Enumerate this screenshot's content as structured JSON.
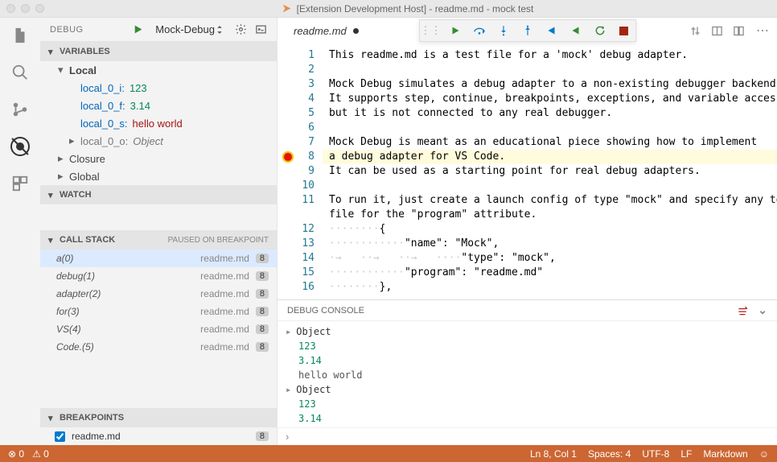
{
  "window": {
    "title": "[Extension Development Host] - readme.md - mock test"
  },
  "debugbar": {
    "label": "DEBUG",
    "config": "Mock-Debug"
  },
  "sections": {
    "variables": "VARIABLES",
    "watch": "WATCH",
    "callstack": "CALL STACK",
    "callstack_status": "PAUSED ON BREAKPOINT",
    "breakpoints": "BREAKPOINTS"
  },
  "vars": {
    "scope_local": "Local",
    "scope_closure": "Closure",
    "scope_global": "Global",
    "items": [
      {
        "name": "local_0_i:",
        "value": "123",
        "vclass": "num"
      },
      {
        "name": "local_0_f:",
        "value": "3.14",
        "vclass": "num"
      },
      {
        "name": "local_0_s:",
        "value": "hello world",
        "vclass": "str"
      },
      {
        "name": "local_0_o:",
        "value": "Object",
        "vclass": "obj"
      }
    ]
  },
  "callstack": [
    {
      "fn": "a(0)",
      "src": "readme.md",
      "ln": "8",
      "sel": true
    },
    {
      "fn": "debug(1)",
      "src": "readme.md",
      "ln": "8"
    },
    {
      "fn": "adapter(2)",
      "src": "readme.md",
      "ln": "8"
    },
    {
      "fn": "for(3)",
      "src": "readme.md",
      "ln": "8"
    },
    {
      "fn": "VS(4)",
      "src": "readme.md",
      "ln": "8"
    },
    {
      "fn": "Code.(5)",
      "src": "readme.md",
      "ln": "8"
    }
  ],
  "breakpoints": [
    {
      "file": "readme.md",
      "ln": "8"
    }
  ],
  "tab": {
    "name": "readme.md"
  },
  "code": {
    "lines": [
      "This readme.md is a test file for a 'mock' debug adapter.",
      "",
      "Mock Debug simulates a debug adapter to a non-existing debugger backend.",
      "It supports step, continue, breakpoints, exceptions, and variable access",
      "but it is not connected to any real debugger.",
      "",
      "Mock Debug is meant as an educational piece showing how to implement",
      "a debug adapter for VS Code.",
      "It can be used as a starting point for real debug adapters.",
      "",
      "To run it, just create a launch config of type \"mock\" and specify any text file for the \"program\" attribute.",
      "········{",
      "············\"name\": \"Mock\",",
      "·→··→··→····\"type\": \"mock\",",
      "············\"program\": \"readme.md\"",
      "········},"
    ],
    "line_numbers": [
      "1",
      "2",
      "3",
      "4",
      "5",
      "6",
      "7",
      "8",
      "9",
      "10",
      "11",
      "",
      "12",
      "13",
      "14",
      "15",
      "16"
    ],
    "highlight_index": 7,
    "bp_gutter_index": 7
  },
  "console": {
    "title": "DEBUG CONSOLE",
    "rows": [
      {
        "t": "Object",
        "c": "obj",
        "exp": true
      },
      {
        "t": "123",
        "c": "num"
      },
      {
        "t": "3.14",
        "c": "num"
      },
      {
        "t": "hello world",
        "c": "str"
      },
      {
        "t": "Object",
        "c": "obj",
        "exp": true
      },
      {
        "t": "123",
        "c": "num"
      },
      {
        "t": "3.14",
        "c": "num"
      }
    ]
  },
  "status": {
    "errors": "0",
    "warnings": "0",
    "pos": "Ln 8, Col 1",
    "spaces": "Spaces: 4",
    "encoding": "UTF-8",
    "eol": "LF",
    "lang": "Markdown"
  }
}
